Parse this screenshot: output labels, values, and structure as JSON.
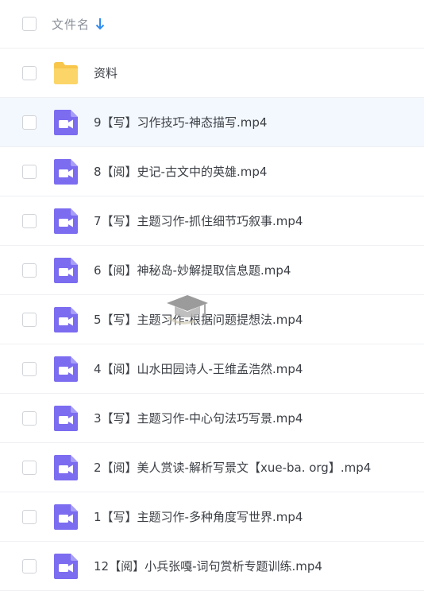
{
  "header": {
    "title": "文件名"
  },
  "files": [
    {
      "name": "资料",
      "type": "folder-icon",
      "selected": false
    },
    {
      "name": "9【写】习作技巧-神态描写.mp4",
      "type": "video-icon",
      "selected": true
    },
    {
      "name": "8【阅】史记-古文中的英雄.mp4",
      "type": "video-icon",
      "selected": false
    },
    {
      "name": "7【写】主题习作-抓住细节巧叙事.mp4",
      "type": "video-icon",
      "selected": false
    },
    {
      "name": "6【阅】神秘岛-妙解提取信息题.mp4",
      "type": "video-icon",
      "selected": false
    },
    {
      "name": "5【写】主题习作-根据问题提想法.mp4",
      "type": "video-icon",
      "selected": false
    },
    {
      "name": "4【阅】山水田园诗人-王维孟浩然.mp4",
      "type": "video-icon",
      "selected": false
    },
    {
      "name": "3【写】主题习作-中心句法巧写景.mp4",
      "type": "video-icon",
      "selected": false
    },
    {
      "name": "2【阅】美人赏读-解析写景文【xue-ba. org】.mp4",
      "type": "video-icon",
      "selected": false
    },
    {
      "name": "1【写】主题习作-多种角度写世界.mp4",
      "type": "video-icon",
      "selected": false
    },
    {
      "name": "12【阅】小兵张嘎-词句赏析专题训练.mp4",
      "type": "video-icon",
      "selected": false
    }
  ],
  "colors": {
    "folder": "#f7c64a",
    "video": "#7b6cf0",
    "selected_row": "#f3f8fe",
    "sort_arrow": "#2f8cf0"
  }
}
